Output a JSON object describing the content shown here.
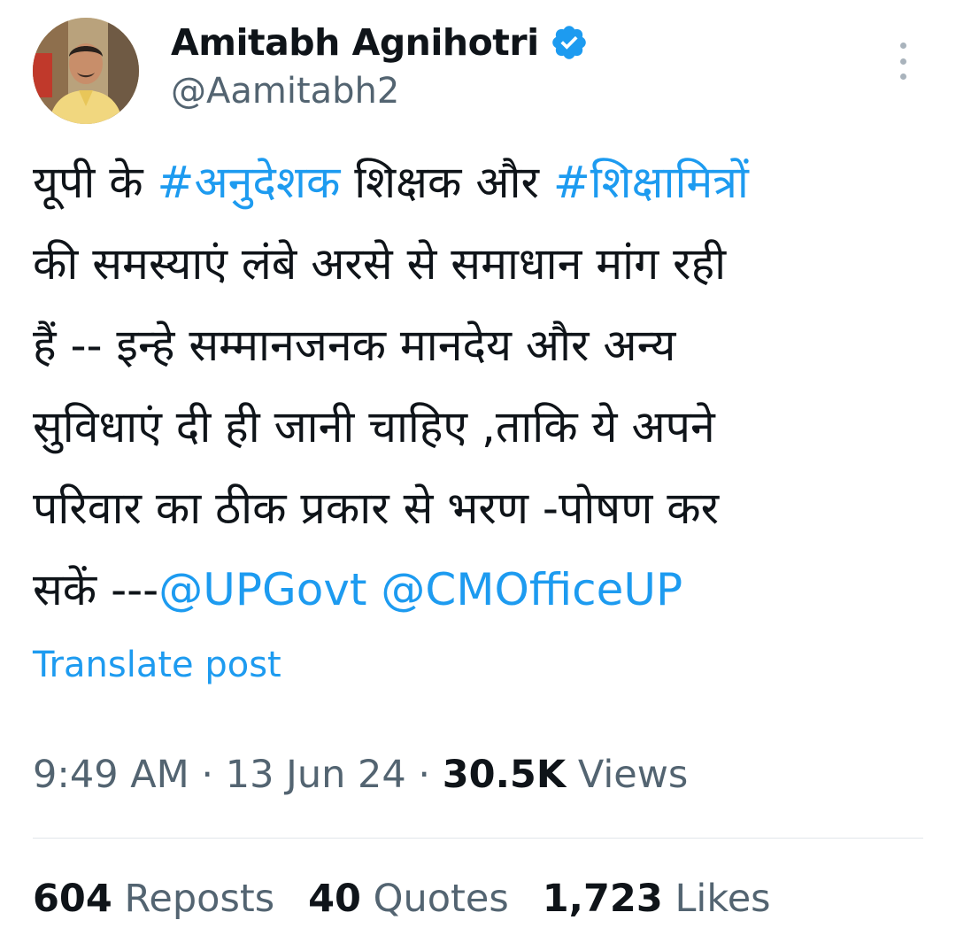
{
  "author": {
    "display_name": "Amitabh Agnihotri",
    "handle": "@Aamitabh2",
    "verified": true
  },
  "tweet": {
    "lines": [
      [
        {
          "text": "यूपी के ",
          "type": "text"
        },
        {
          "text": "#अनुदेशक",
          "type": "link"
        },
        {
          "text": " शिक्षक और ",
          "type": "text"
        },
        {
          "text": "#शिक्षामित्रों",
          "type": "link"
        }
      ],
      [
        {
          "text": "की समस्याएं लंबे अरसे से समाधान मांग रही",
          "type": "text"
        }
      ],
      [
        {
          "text": "हैं -- इन्हे सम्मानजनक मानदेय और अन्य",
          "type": "text"
        }
      ],
      [
        {
          "text": "सुविधाएं दी ही जानी चाहिए ,ताकि ये अपने",
          "type": "text"
        }
      ],
      [
        {
          "text": "परिवार का ठीक प्रकार से भरण -पोषण कर",
          "type": "text"
        }
      ],
      [
        {
          "text": "सकें ---",
          "type": "text"
        },
        {
          "text": "@UPGovt",
          "type": "link"
        },
        {
          "text": " ",
          "type": "text"
        },
        {
          "text": "@CMOfficeUP",
          "type": "link"
        }
      ]
    ],
    "translate_label": "Translate post"
  },
  "meta": {
    "time": "9:49 AM",
    "separator": " · ",
    "date": "13 Jun 24",
    "views_count": "30.5K",
    "views_label": "Views"
  },
  "stats": {
    "reposts_count": "604",
    "reposts_label": "Reposts",
    "quotes_count": "40",
    "quotes_label": "Quotes",
    "likes_count": "1,723",
    "likes_label": "Likes"
  },
  "colors": {
    "link": "#1d9bf0",
    "text": "#0f1419",
    "secondary": "#536471",
    "verified_badge": "#1d9bf0"
  },
  "icons": {
    "verified": "verified-badge-icon",
    "more": "more-options-icon"
  }
}
